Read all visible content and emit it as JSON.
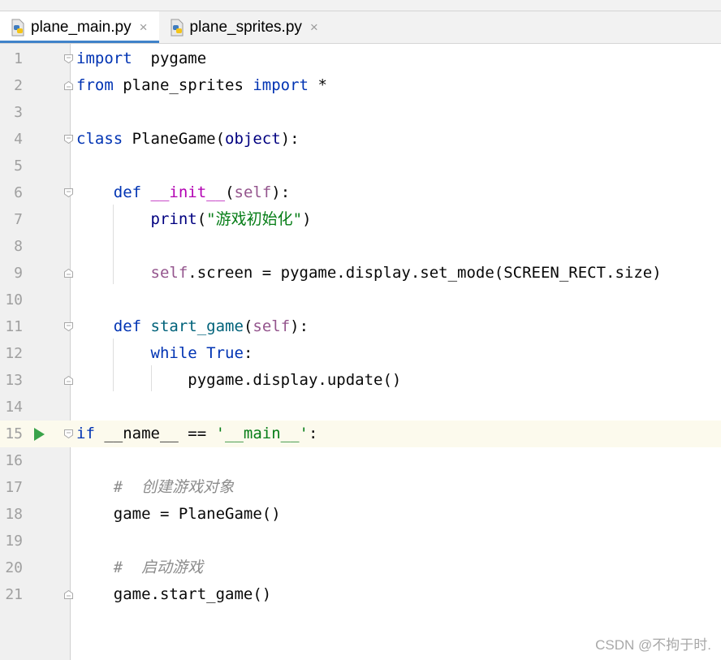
{
  "tabs": [
    {
      "label": "plane_main.py",
      "active": true,
      "close": "×"
    },
    {
      "label": "plane_sprites.py",
      "active": false,
      "close": "×"
    }
  ],
  "lines": [
    {
      "n": "1",
      "tokens": [
        [
          "kw",
          "import"
        ],
        [
          "",
          "  pygame"
        ]
      ]
    },
    {
      "n": "2",
      "tokens": [
        [
          "kw",
          "from"
        ],
        [
          "",
          " plane_sprites "
        ],
        [
          "kw",
          "import"
        ],
        [
          "",
          " *"
        ]
      ]
    },
    {
      "n": "3",
      "tokens": []
    },
    {
      "n": "4",
      "tokens": [
        [
          "kw",
          "class"
        ],
        [
          "",
          " PlaneGame("
        ],
        [
          "bi",
          "object"
        ],
        [
          "",
          "):"
        ]
      ]
    },
    {
      "n": "5",
      "tokens": []
    },
    {
      "n": "6",
      "tokens": [
        [
          "",
          "    "
        ],
        [
          "kw",
          "def"
        ],
        [
          "",
          " "
        ],
        [
          "dunder",
          "__init__"
        ],
        [
          "",
          "("
        ],
        [
          "self",
          "self"
        ],
        [
          "",
          "):"
        ]
      ]
    },
    {
      "n": "7",
      "tokens": [
        [
          "",
          "        "
        ],
        [
          "bi",
          "print"
        ],
        [
          "",
          "("
        ],
        [
          "str",
          "\"游戏初始化\""
        ],
        [
          "",
          ")"
        ]
      ]
    },
    {
      "n": "8",
      "tokens": []
    },
    {
      "n": "9",
      "tokens": [
        [
          "",
          "        "
        ],
        [
          "self",
          "self"
        ],
        [
          "",
          ".screen = pygame.display.set_mode(SCREEN_RECT.size)"
        ]
      ]
    },
    {
      "n": "10",
      "tokens": []
    },
    {
      "n": "11",
      "tokens": [
        [
          "",
          "    "
        ],
        [
          "kw",
          "def"
        ],
        [
          "",
          " "
        ],
        [
          "fn",
          "start_game"
        ],
        [
          "",
          "("
        ],
        [
          "self",
          "self"
        ],
        [
          "",
          "):"
        ]
      ]
    },
    {
      "n": "12",
      "tokens": [
        [
          "",
          "        "
        ],
        [
          "kw",
          "while"
        ],
        [
          "",
          " "
        ],
        [
          "kw",
          "True"
        ],
        [
          "",
          ":"
        ]
      ]
    },
    {
      "n": "13",
      "tokens": [
        [
          "",
          "            pygame.display.update()"
        ]
      ]
    },
    {
      "n": "14",
      "tokens": []
    },
    {
      "n": "15",
      "tokens": [
        [
          "kw",
          "if"
        ],
        [
          "",
          " __name__ == "
        ],
        [
          "str",
          "'__main__'"
        ],
        [
          "",
          ":"
        ]
      ]
    },
    {
      "n": "16",
      "tokens": []
    },
    {
      "n": "17",
      "tokens": [
        [
          "",
          "    "
        ],
        [
          "cmt",
          "#  创建游戏对象"
        ]
      ]
    },
    {
      "n": "18",
      "tokens": [
        [
          "",
          "    game = PlaneGame()"
        ]
      ]
    },
    {
      "n": "19",
      "tokens": []
    },
    {
      "n": "20",
      "tokens": [
        [
          "",
          "    "
        ],
        [
          "cmt",
          "#  启动游戏"
        ]
      ]
    },
    {
      "n": "21",
      "tokens": [
        [
          "",
          "    game.start_game()"
        ]
      ]
    }
  ],
  "current_line": "15",
  "run_line": "15",
  "fold_open_lines": [
    "1",
    "4",
    "6",
    "11",
    "15"
  ],
  "fold_close_lines": [
    "2",
    "9",
    "13",
    "21"
  ],
  "watermark": "CSDN @不拘于时.",
  "colors": {
    "keyword": "#0033b3",
    "builtin": "#000080",
    "self": "#94558d",
    "dunder": "#b200b2",
    "function": "#00627a",
    "string": "#067d17",
    "comment": "#8c8c8c",
    "active_tab_underline": "#4083c9",
    "run_icon": "#3aa34a"
  }
}
